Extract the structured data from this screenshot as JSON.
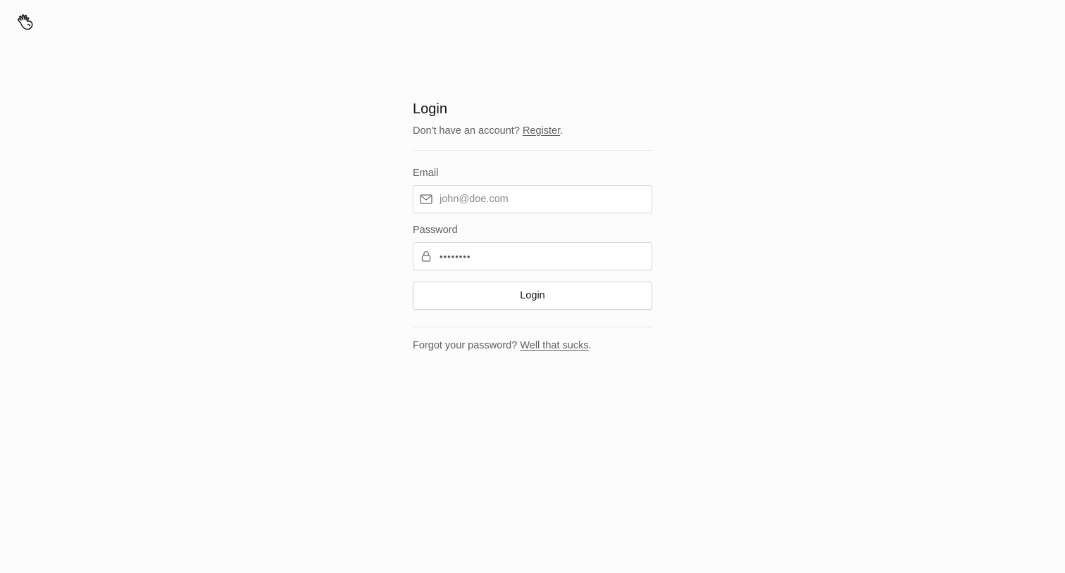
{
  "header": {
    "logo_icon": "hand-wave-icon"
  },
  "login": {
    "title": "Login",
    "subtitle_prefix": "Don't have an account? ",
    "register_link": "Register",
    "subtitle_suffix": ".",
    "email_label": "Email",
    "email_placeholder": "john@doe.com",
    "email_icon": "mail-icon",
    "password_label": "Password",
    "password_value": "••••••••",
    "password_icon": "lock-icon",
    "submit_label": "Login",
    "forgot_prefix": "Forgot your password? ",
    "forgot_link": "Well that sucks",
    "forgot_suffix": "."
  },
  "colors": {
    "background": "#fcfcfc",
    "text_primary": "#111111",
    "text_secondary": "#5f5f5f",
    "border": "#d9d9d9"
  }
}
